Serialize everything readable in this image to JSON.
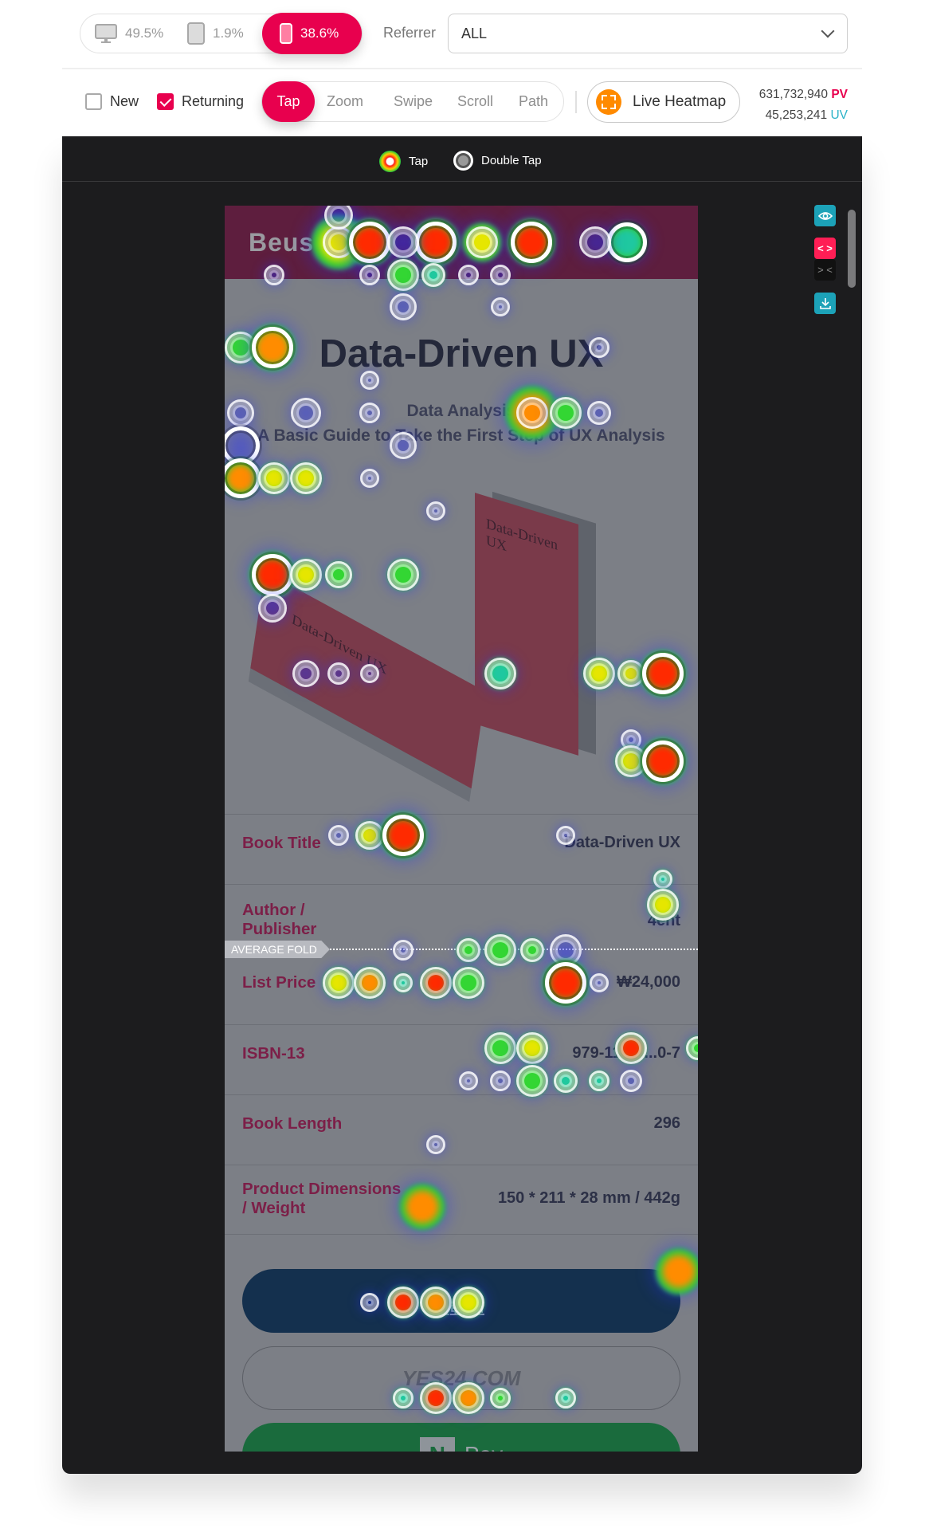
{
  "devices": [
    {
      "name": "desktop",
      "percent": "49.5%",
      "active": false
    },
    {
      "name": "tablet",
      "percent": "1.9%",
      "active": false
    },
    {
      "name": "mobile",
      "percent": "38.6%",
      "active": true
    }
  ],
  "referrer": {
    "label": "Referrer",
    "value": "ALL"
  },
  "visitor_filters": [
    {
      "label": "New",
      "checked": false
    },
    {
      "label": "Returning",
      "checked": true
    }
  ],
  "modes": [
    "Tap",
    "Zoom",
    "Swipe",
    "Scroll",
    "Path"
  ],
  "active_mode": "Tap",
  "live_heatmap_label": "Live Heatmap",
  "stats": {
    "pv_value": "631,732,940",
    "pv_label": "PV",
    "uv_value": "45,253,241",
    "uv_label": "UV"
  },
  "legend": {
    "tap": "Tap",
    "double_tap": "Double Tap"
  },
  "side_tools": {
    "expand": "< >",
    "collapse": "> <"
  },
  "colors": {
    "accent": "#e8004e",
    "uv": "#2bb3c8",
    "live": "#ff8a00",
    "tool": "#1ca2b8"
  },
  "page": {
    "logo": "Beus",
    "title": "Data-Driven UX",
    "subtitle1": "Data Analysis",
    "subtitle2": "A Basic Guide to Take the First Step of UX Analysis",
    "book_cover_text": "Data-Driven UX",
    "details": [
      {
        "key": "Book Title",
        "value": "Data-Driven UX"
      },
      {
        "key": "Author / Publisher",
        "value": "4ent"
      },
      {
        "key": "List Price",
        "value": "₩24,000"
      },
      {
        "key": "ISBN-13",
        "value": "979-11-96...0-7"
      },
      {
        "key": "Book Length",
        "value": "296"
      },
      {
        "key": "Product Dimensions / Weight",
        "value": "150 * 211 * 28 mm / 442g"
      }
    ],
    "fold_label": "AVERAGE FOLD",
    "buttons": {
      "kyobo": "교보문고",
      "yes24": "YES24.COM",
      "npay_n": "N",
      "npay": "Pay"
    }
  }
}
